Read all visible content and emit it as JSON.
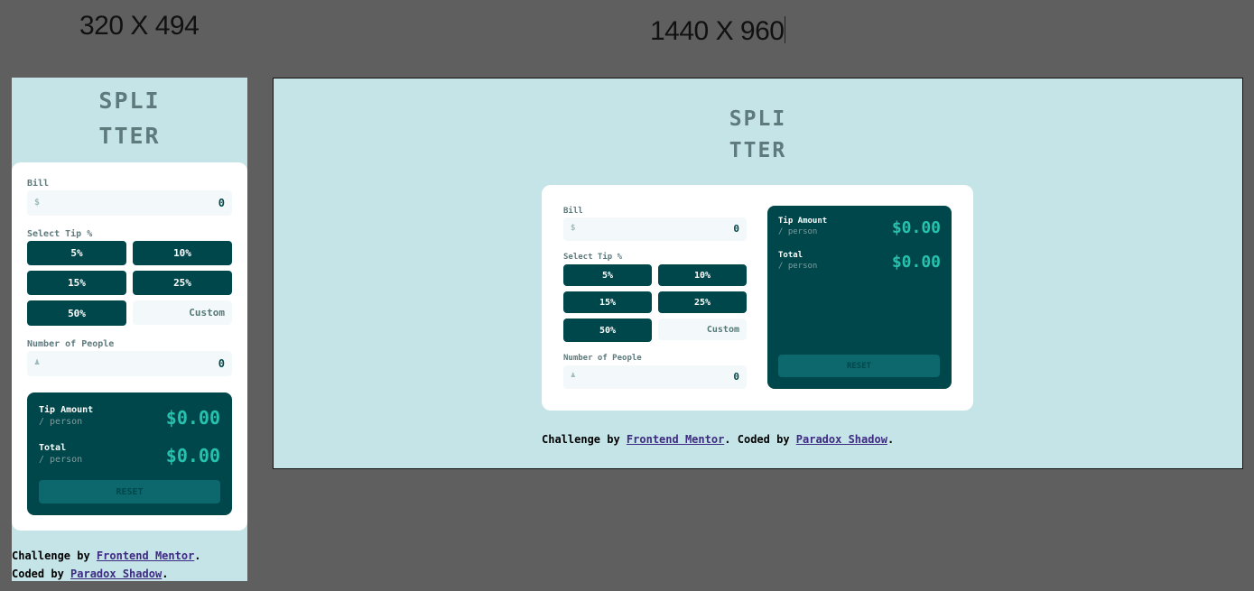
{
  "labels": {
    "mobile_size": "320 X 494",
    "desktop_size": "1440 X 960"
  },
  "app": {
    "logo_line1": "SPLI",
    "logo_line2": "TTER",
    "bill_label": "Bill",
    "bill_icon": "$",
    "bill_value": "0",
    "tip_label": "Select Tip %",
    "tips": [
      "5%",
      "10%",
      "15%",
      "25%",
      "50%"
    ],
    "custom_placeholder": "Custom",
    "people_label": "Number of People",
    "people_icon": "person-icon",
    "people_value": "0",
    "tip_amount_label": "Tip Amount",
    "per_person": "/ person",
    "tip_amount_value": "$0.00",
    "total_label": "Total",
    "total_value": "$0.00",
    "reset_label": "RESET"
  },
  "credit": {
    "prefix": "Challenge by ",
    "frontend_link": "Frontend Mentor",
    "middle": ". Coded by ",
    "author_link": "Paradox Shadow",
    "suffix": "."
  },
  "colors": {
    "background": "#c5e4e7",
    "dark_cyan": "#00474b",
    "accent_cyan": "#26c2ae",
    "grayish_cyan": "#5e7a7d"
  }
}
